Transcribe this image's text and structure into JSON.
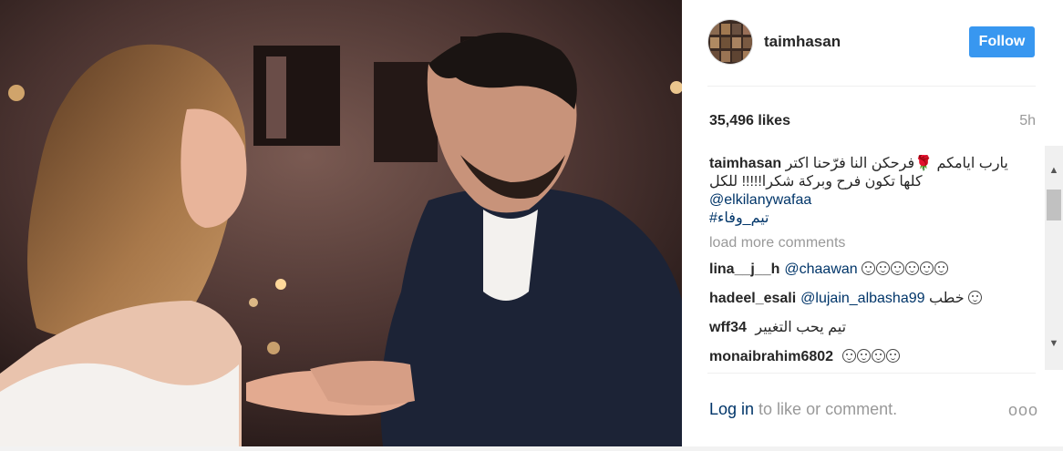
{
  "post": {
    "username": "taimhasan",
    "follow_label": "Follow",
    "likes": "35,496 likes",
    "time": "5h",
    "caption_user": "taimhasan",
    "caption_line1": "يارب ايامكم  🌹فرحكن النا فرّحنا اكتر",
    "caption_line2": "كلها تكون فرح وبركة شكرا!!!!! للكل",
    "caption_mention": "@elkilanywafaa",
    "caption_hashtag": "#تيم_وفاء",
    "load_more": "load more comments"
  },
  "comments": [
    {
      "user": "lina__j__h",
      "mention": "@chaawan",
      "text": "",
      "emojis": 6
    },
    {
      "user": "hadeel_esali",
      "mention": "@lujain_albasha99",
      "text": "خطب",
      "emojis": 1
    },
    {
      "user": "wff34",
      "mention": "",
      "text": "تيم يحب التغيير",
      "emojis": 0
    },
    {
      "user": "monaibrahim6802",
      "mention": "",
      "text": "",
      "emojis": 4
    }
  ],
  "footer": {
    "login": "Log in",
    "rest": " to like or comment.",
    "more": "ooo"
  },
  "colors": {
    "follow_bg": "#3897f0",
    "link": "#003569",
    "muted": "#999999"
  }
}
